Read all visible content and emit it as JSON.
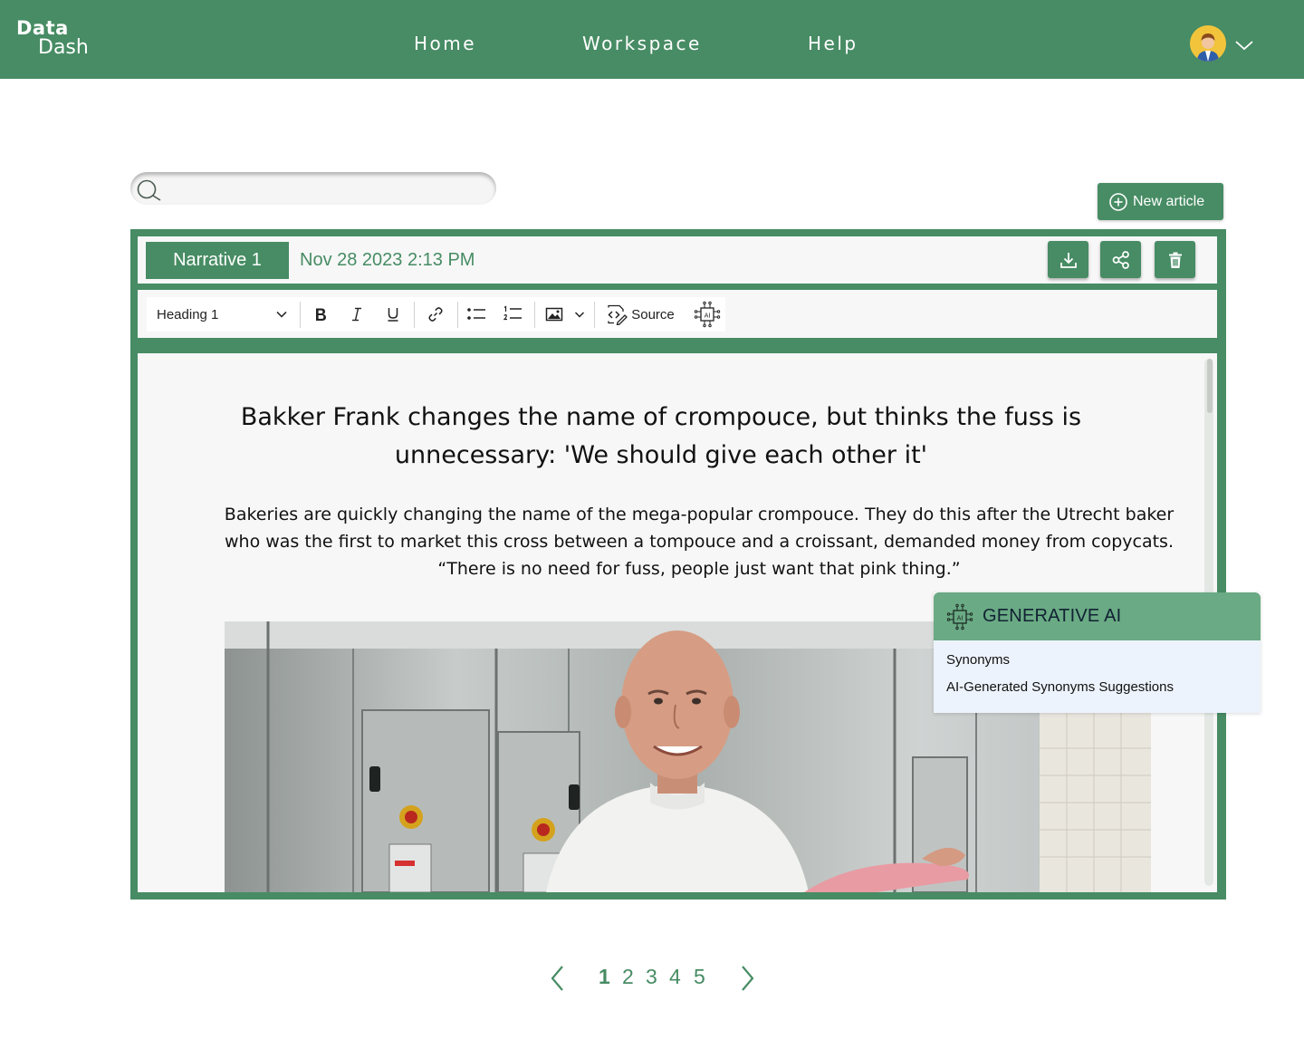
{
  "app": {
    "logo_line1": "Data",
    "logo_line2": "Dash"
  },
  "nav": {
    "home": "Home",
    "workspace": "Workspace",
    "help": "Help"
  },
  "search": {
    "value": "",
    "placeholder": ""
  },
  "actions": {
    "new_article": "New article"
  },
  "narrative": {
    "tab_label": "Narrative 1",
    "date": "Nov 28 2023 2:13 PM"
  },
  "toolbar": {
    "heading_select": "Heading 1",
    "source_label": "Source",
    "icons": [
      "bold-icon",
      "italic-icon",
      "underline-icon",
      "link-icon",
      "bulleted-list-icon",
      "numbered-list-icon",
      "image-icon",
      "source-icon",
      "ai-chip-icon"
    ]
  },
  "article": {
    "title": "Bakker Frank changes the name of crompouce, but thinks the fuss is unnecessary: 'We should give each other it'",
    "lead": "Bakeries are quickly changing the name of the mega-popular crompouce. They do this after the Utrecht baker who was the first to market this cross between a tompouce and a croissant, demanded money from copycats. “There is no need for fuss, people just want that pink thing.”"
  },
  "ai_panel": {
    "title": "GENERATIVE AI",
    "items": [
      "Synonyms",
      "AI-Generated Synonyms Suggestions"
    ]
  },
  "pagination": {
    "pages": [
      "1",
      "2",
      "3",
      "4",
      "5"
    ],
    "current": "1"
  },
  "colors": {
    "brand_green": "#478c64",
    "ai_header": "#6aaa84",
    "ai_body": "#edf3fc"
  }
}
